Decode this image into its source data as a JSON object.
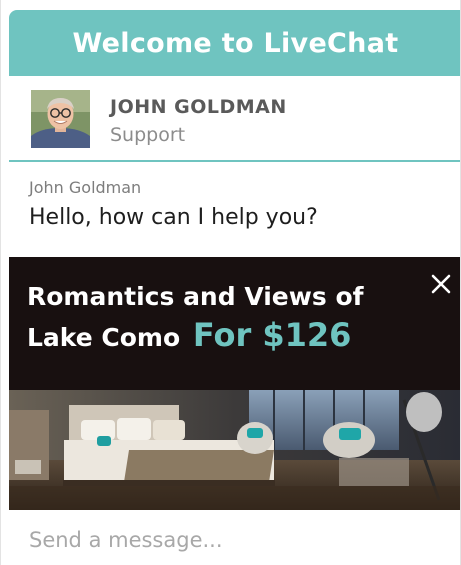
{
  "header": {
    "title": "Welcome to LiveChat"
  },
  "agent": {
    "name": "JOHN GOLDMAN",
    "role": "Support"
  },
  "message": {
    "sender": "John Goldman",
    "text": "Hello, how can I help you?"
  },
  "ad": {
    "title": "Romantics and Views of Lake Como",
    "price": "For $126",
    "close_icon": "close-icon"
  },
  "input": {
    "placeholder": "Send a message..."
  },
  "colors": {
    "accent": "#6fc4c0",
    "ad_background": "#181010",
    "text_dark": "#1e1e1e",
    "text_muted": "#8c8c8c"
  }
}
